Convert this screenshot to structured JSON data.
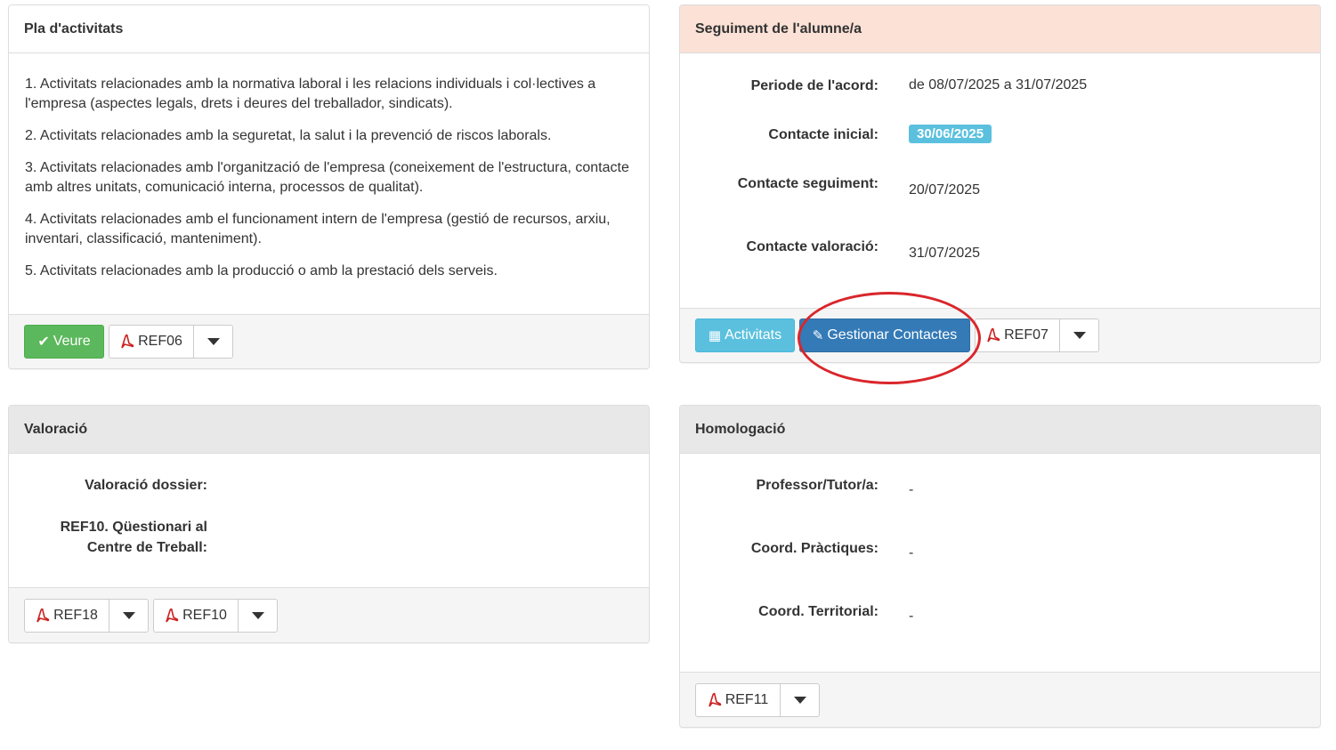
{
  "pla": {
    "title": "Pla d'activitats",
    "activities": [
      "1. Activitats relacionades amb la normativa laboral i les relacions individuals i col·lectives a l'empresa (aspectes legals, drets i deures del treballador, sindicats).",
      "2. Activitats relacionades amb la seguretat, la salut i la prevenció de riscos laborals.",
      "3. Activitats relacionades amb l'organització de l'empresa (coneixement de l'estructura, contacte amb altres unitats, comunicació interna, processos de qualitat).",
      "4. Activitats relacionades amb el funcionament intern de l'empresa (gestió de recursos, arxiu, inventari, classificació, manteniment).",
      "5. Activitats relacionades amb la producció o amb la prestació dels serveis."
    ],
    "veure_label": "Veure",
    "ref_label": "REF06"
  },
  "seguiment": {
    "title": "Seguiment de l'alumne/a",
    "periode_label": "Periode de l'acord:",
    "periode_value": "de 08/07/2025 a 31/07/2025",
    "contacte_inicial_label": "Contacte inicial:",
    "contacte_inicial_value": "30/06/2025",
    "contacte_seguiment_label": "Contacte seguiment:",
    "contacte_seguiment_value": "20/07/2025",
    "contacte_valoracio_label": "Contacte valoració:",
    "contacte_valoracio_value": "31/07/2025",
    "activitats_label": "Activitats",
    "gestionar_label": "Gestionar Contactes",
    "ref_label": "REF07"
  },
  "valoracio": {
    "title": "Valoració",
    "dossier_label": "Valoració dossier:",
    "ref10_label_line1": "REF10. Qüestionari al",
    "ref10_label_line2": "Centre de Treball:",
    "ref18_label": "REF18",
    "ref10_label": "REF10"
  },
  "homologacio": {
    "title": "Homologació",
    "professor_label": "Professor/Tutor/a:",
    "professor_value": "-",
    "coord_practiques_label": "Coord. Pràctiques:",
    "coord_practiques_value": "-",
    "coord_territorial_label": "Coord. Territorial:",
    "coord_territorial_value": "-",
    "ref_label": "REF11"
  },
  "colors": {
    "success": "#5cb85c",
    "info": "#5bc0de",
    "primary": "#337ab7",
    "highlight_ellipse": "#d9262b",
    "pink_heading": "#fbe1d6"
  }
}
